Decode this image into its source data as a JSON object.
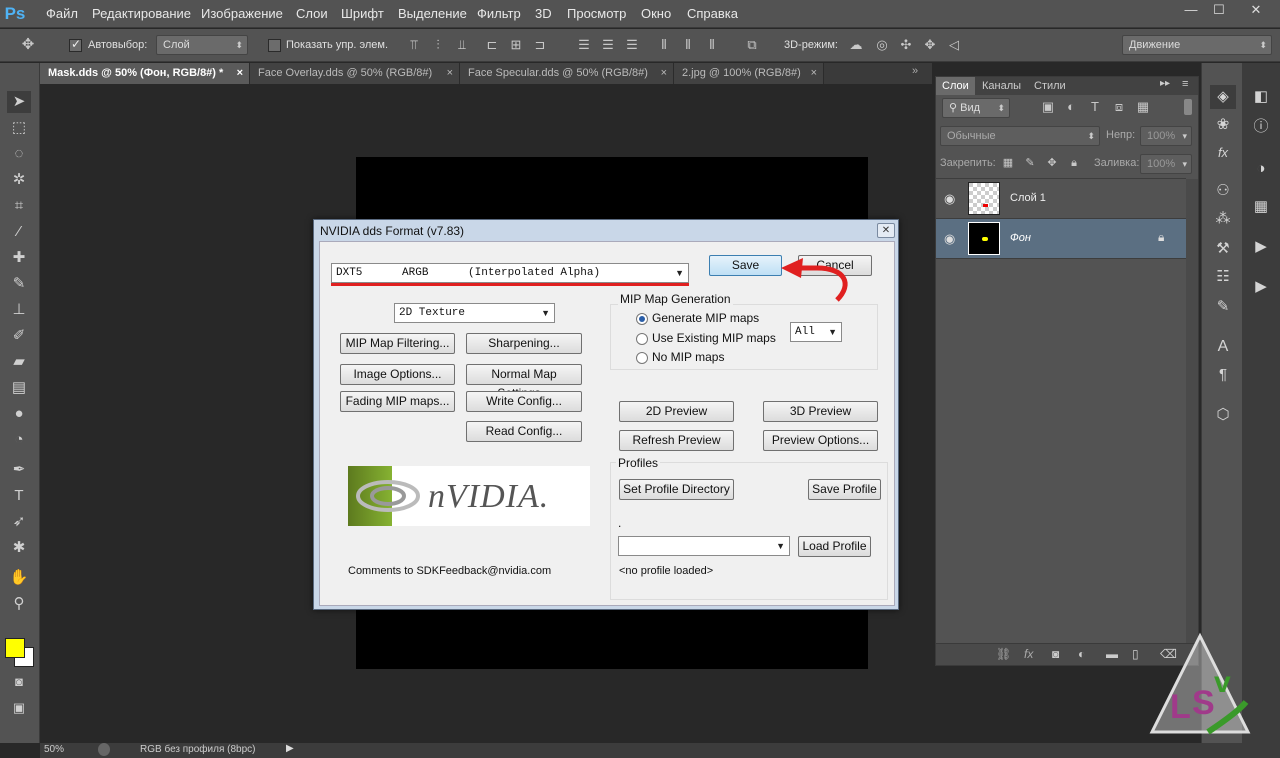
{
  "app": {
    "logo": "Ps"
  },
  "menu": [
    "Файл",
    "Редактирование",
    "Изображение",
    "Слои",
    "Шрифт",
    "Выделение",
    "Фильтр",
    "3D",
    "Просмотр",
    "Окно",
    "Справка"
  ],
  "window_controls": {
    "minimize": "—",
    "maximize": "☐",
    "close": "✕"
  },
  "options": {
    "autoselect_label": "Автовыбор:",
    "autoselect_value": "Слой",
    "show_controls_label": "Показать упр. элем.",
    "mode3d_label": "3D-режим:",
    "workspace": "Движение"
  },
  "tabs": [
    "Mask.dds @ 50% (Фон, RGB/8#) *",
    "Face Overlay.dds @ 50% (RGB/8#)",
    "Face Specular.dds @ 50% (RGB/8#)",
    "2.jpg @ 100% (RGB/8#)"
  ],
  "tab_close": "×",
  "layers_panel": {
    "tabs": [
      "Слои",
      "Каналы",
      "Стили"
    ],
    "kind_filter": "Вид",
    "blend_mode": "Обычные",
    "opacity_label": "Непр:",
    "opacity_value": "100%",
    "lock_label": "Закрепить:",
    "fill_label": "Заливка:",
    "fill_value": "100%",
    "layers": [
      {
        "name": "Слой 1",
        "selected": false,
        "locked": false
      },
      {
        "name": "Фон",
        "selected": true,
        "locked": true
      }
    ]
  },
  "status": {
    "zoom": "50%",
    "profile": "RGB без профиля (8bpc)"
  },
  "dialog": {
    "title": "NVIDIA dds Format (v7.83)",
    "close": "✕",
    "format": "DXT5      ARGB      (Interpolated Alpha)",
    "texture_type": "2D Texture",
    "save": "Save",
    "cancel": "Cancel",
    "buttons_left": [
      "MIP Map Filtering...",
      "Sharpening...",
      "Image Options...",
      "Normal Map Settings...",
      "Fading MIP maps...",
      "Write Config...",
      "Read Config..."
    ],
    "mip_group": "MIP Map Generation",
    "mip_options": [
      "Generate MIP maps",
      "Use Existing MIP maps",
      "No MIP maps"
    ],
    "mip_selected": 0,
    "mip_count": "All",
    "preview_2d": "2D Preview",
    "preview_3d": "3D Preview",
    "refresh_preview": "Refresh Preview",
    "preview_options": "Preview Options...",
    "profiles_group": "Profiles",
    "set_profile_dir": "Set Profile Directory",
    "save_profile": "Save Profile",
    "profile_dot": ".",
    "load_profile": "Load Profile",
    "no_profile": "<no profile loaded>",
    "comments": "Comments to SDKFeedback@nvidia.com",
    "logo_text": "nVIDIA.",
    "accent_red": "#e02020"
  }
}
